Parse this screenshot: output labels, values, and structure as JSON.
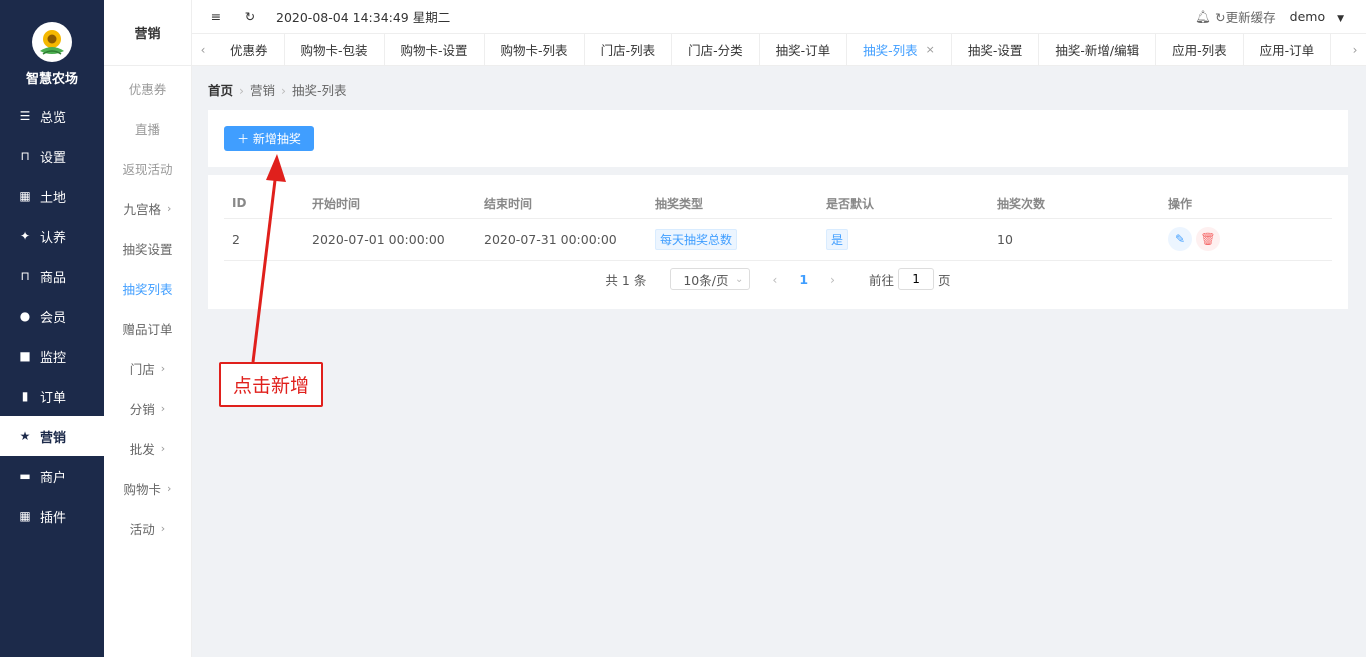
{
  "brand": {
    "name": "智慧农场"
  },
  "sidebar": {
    "items": [
      {
        "label": "总览",
        "icon": "sliders-icon"
      },
      {
        "label": "设置",
        "icon": "bag-icon"
      },
      {
        "label": "土地",
        "icon": "grid-icon"
      },
      {
        "label": "认养",
        "icon": "badge-icon"
      },
      {
        "label": "商品",
        "icon": "bag-icon"
      },
      {
        "label": "会员",
        "icon": "user-icon"
      },
      {
        "label": "监控",
        "icon": "camera-icon"
      },
      {
        "label": "订单",
        "icon": "clipboard-icon"
      },
      {
        "label": "营销",
        "icon": "star-icon",
        "active": true
      },
      {
        "label": "商户",
        "icon": "store-icon"
      },
      {
        "label": "插件",
        "icon": "grid-icon"
      }
    ]
  },
  "subbar": {
    "title": "营销",
    "items": [
      {
        "label": "优惠券"
      },
      {
        "label": "直播"
      },
      {
        "label": "返现活动"
      },
      {
        "label": "九宫格"
      },
      {
        "label": "抽奖设置"
      },
      {
        "label": "抽奖列表"
      },
      {
        "label": "赠品订单"
      },
      {
        "label": "门店"
      },
      {
        "label": "分销"
      },
      {
        "label": "批发"
      },
      {
        "label": "购物卡"
      },
      {
        "label": "活动"
      }
    ]
  },
  "topbar": {
    "datetime": "2020-08-04 14:34:49 星期二",
    "refresh_label": "更新缓存",
    "user": "demo"
  },
  "tabs": [
    "优惠券",
    "购物卡-包装",
    "购物卡-设置",
    "购物卡-列表",
    "门店-列表",
    "门店-分类",
    "抽奖-订单",
    "抽奖-列表",
    "抽奖-设置",
    "抽奖-新增/编辑",
    "应用-列表",
    "应用-订单"
  ],
  "breadcrumb": {
    "home": "首页",
    "section": "营销",
    "page": "抽奖-列表"
  },
  "add_button": {
    "label": "新增抽奖"
  },
  "table": {
    "headers": [
      "ID",
      "开始时间",
      "结束时间",
      "抽奖类型",
      "是否默认",
      "抽奖次数",
      "操作"
    ],
    "rows": [
      {
        "id": "2",
        "start": "2020-07-01 00:00:00",
        "end": "2020-07-31 00:00:00",
        "type": "每天抽奖总数",
        "default": "是",
        "count": "10"
      }
    ]
  },
  "pager": {
    "total": "共 1 条",
    "page_size": "10条/页",
    "current": "1",
    "goto_prefix": "前往",
    "goto_value": "1",
    "goto_suffix": "页"
  },
  "annotation": {
    "text": "点击新增",
    "color": "#e0201c"
  },
  "colors": {
    "primary": "#409eff",
    "sidebar": "#1c2a4a",
    "danger": "#f56c6c"
  }
}
